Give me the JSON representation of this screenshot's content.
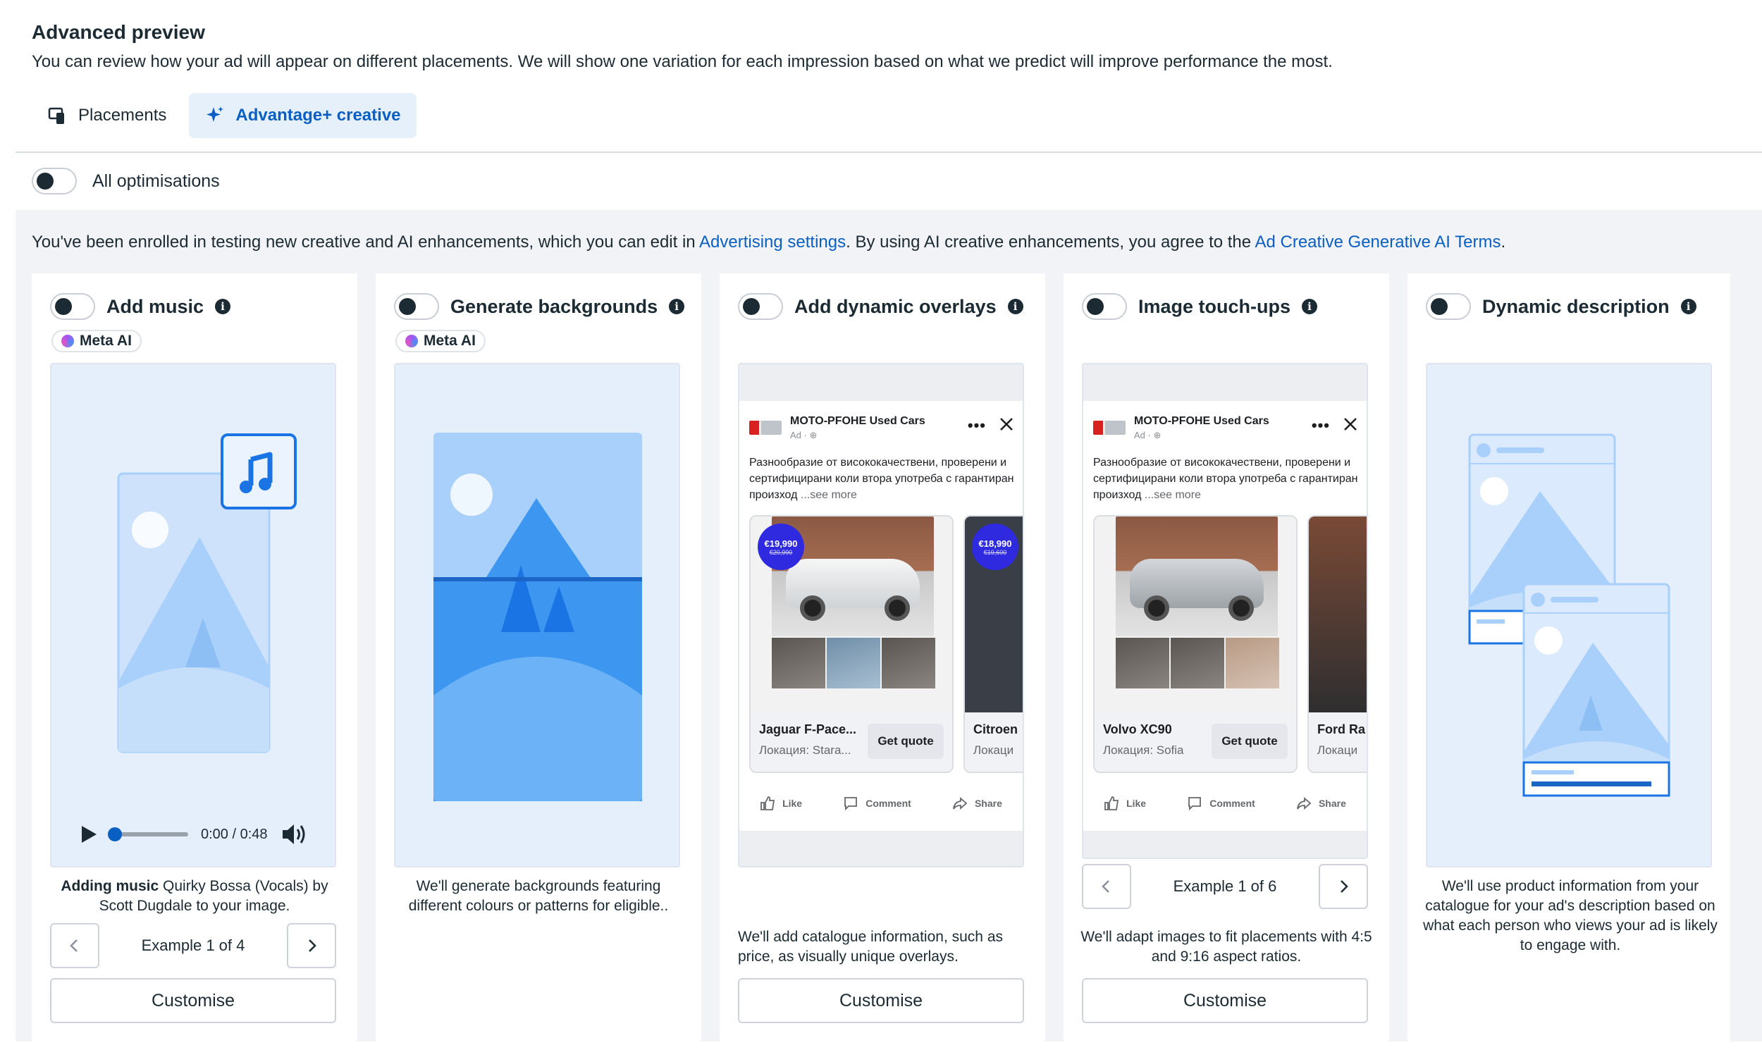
{
  "header": {
    "title": "Advanced preview",
    "subtitle": "You can review how your ad will appear on different placements. We will show one variation for each impression based on what we predict will improve performance the most."
  },
  "tabs": [
    {
      "label": "Placements",
      "icon": "placements-icon"
    },
    {
      "label": "Advantage+ creative",
      "icon": "sparkle-icon"
    }
  ],
  "all_optimisations": {
    "label": "All optimisations",
    "enabled": false
  },
  "notice": {
    "part1": "You've been enrolled in testing new creative and AI enhancements, which you can edit in ",
    "link1": "Advertising settings",
    "part2": ". By using AI creative enhancements, you agree to the ",
    "link2": "Ad Creative Generative AI Terms",
    "part3": "."
  },
  "meta_ai_label": "Meta AI",
  "cards": {
    "music": {
      "title": "Add music",
      "caption_bold": "Adding music",
      "caption_rest": " Quirky Bossa (Vocals) by Scott Dugdale to your image.",
      "time": "0:00 / 0:48",
      "example": "Example 1 of 4",
      "customise": "Customise"
    },
    "backgrounds": {
      "title": "Generate backgrounds",
      "caption": "We'll generate backgrounds featuring different colours or patterns for eligible.."
    },
    "overlays": {
      "title": "Add dynamic overlays",
      "caption": "We'll add catalogue information, such as price, as visually unique overlays.",
      "customise": "Customise"
    },
    "touchups": {
      "title": "Image touch-ups",
      "caption": "We'll adapt images to fit placements with 4:5 and 9:16 aspect ratios.",
      "example": "Example 1 of 6",
      "customise": "Customise"
    },
    "description": {
      "title": "Dynamic description",
      "caption": "We'll use product information from your catalogue for your ad's description based on what each person who views your ad is likely to engage with."
    }
  },
  "ad_mock": {
    "page_name": "MOTO-PFOHE Used Cars",
    "sponsored": "Ad · ⊕",
    "body": "Разнообразие от висококачествени, проверени и сертифицирани коли втора употреба с гарантиран произход",
    "see_more": "...see more",
    "like": "Like",
    "comment": "Comment",
    "share": "Share",
    "cta": "Get quote",
    "overlay_items": [
      {
        "title": "Jaguar F-Pace...",
        "location": "Локация: Stara...",
        "price": "€19,990",
        "old_price": "€20,990"
      },
      {
        "title": "Citroen",
        "location": "Локаци",
        "price": "€18,990",
        "old_price": "€19,600"
      }
    ],
    "touchup_items": [
      {
        "title": "Volvo XC90",
        "location": "Локация: Sofia"
      },
      {
        "title": "Ford Ra",
        "location": "Локаци"
      }
    ]
  },
  "colors": {
    "accent": "#0a5fc2",
    "illustration_light": "#a9d0fb",
    "illustration_dark": "#3d97f0"
  }
}
